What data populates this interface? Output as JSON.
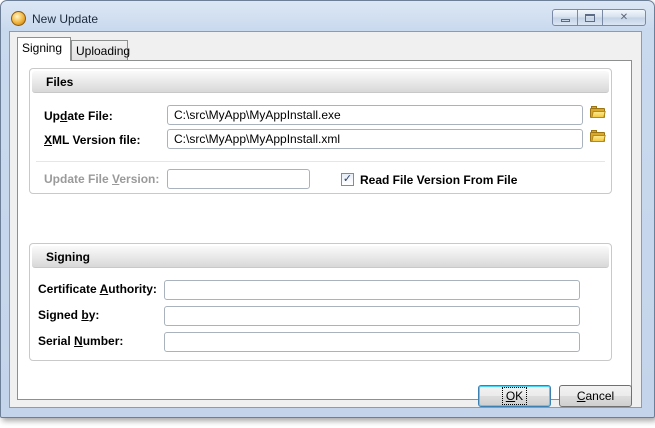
{
  "window": {
    "title": "New Update",
    "icon": "update-app-icon"
  },
  "tabs": [
    {
      "label": "Signing",
      "active": true
    },
    {
      "label": "Uploading",
      "active": false
    }
  ],
  "files_group": {
    "title": "Files",
    "update_file": {
      "label_pre": "Up",
      "label_key": "d",
      "label_post": "ate File:",
      "value": "C:\\src\\MyApp\\MyAppInstall.exe"
    },
    "xml_file": {
      "label_pre": "",
      "label_key": "X",
      "label_post": "ML Version file:",
      "value": "C:\\src\\MyApp\\MyAppInstall.xml"
    },
    "version": {
      "label_pre": "Update File ",
      "label_key": "V",
      "label_post": "ersion:",
      "value": ""
    },
    "read_version_checkbox": {
      "label": "Read File Version From File",
      "checked": true
    }
  },
  "signing_group": {
    "title": "Signing",
    "cert_authority": {
      "label_pre": "Certificate ",
      "label_key": "A",
      "label_post": "uthority:",
      "value": ""
    },
    "signed_by": {
      "label_pre": "Signed ",
      "label_key": "b",
      "label_post": "y:",
      "value": ""
    },
    "serial_number": {
      "label_pre": "Serial ",
      "label_key": "N",
      "label_post": "umber:",
      "value": ""
    }
  },
  "buttons": {
    "ok": {
      "label_key": "O",
      "label_post": "K"
    },
    "cancel": {
      "label_key": "C",
      "label_post": "ancel"
    }
  },
  "colors": {
    "titlebar": "#c9d9ee",
    "default_button_border": "#3c7fb1",
    "folder_icon": "#f3c942"
  }
}
